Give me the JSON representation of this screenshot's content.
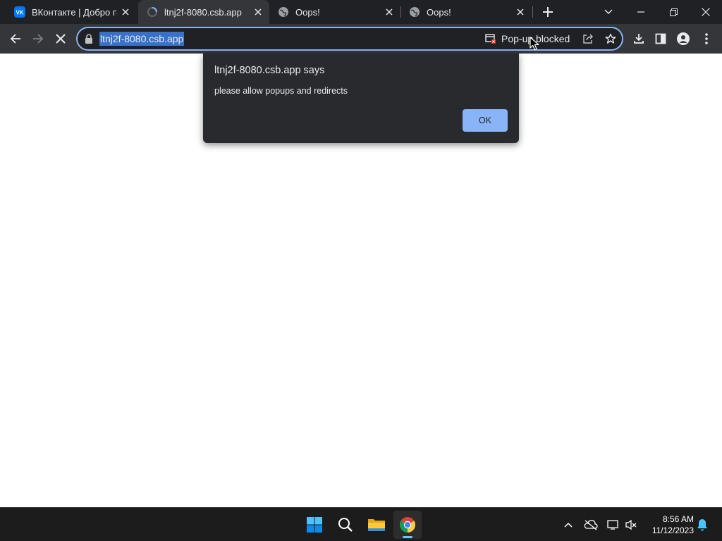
{
  "browser": {
    "tabs": [
      {
        "title": "ВКонтакте | Добро пожаловать",
        "favicon": "vk-icon",
        "active": false
      },
      {
        "title": "ltnj2f-8080.csb.app",
        "favicon": "loading-spinner-icon",
        "active": true
      },
      {
        "title": "Oops!",
        "favicon": "globe-icon",
        "active": false
      },
      {
        "title": "Oops!",
        "favicon": "globe-icon",
        "active": false
      }
    ],
    "address_bar": {
      "url": "ltnj2f-8080.csb.app",
      "popup_blocked_label": "Pop-up blocked"
    }
  },
  "dialog": {
    "title": "ltnj2f-8080.csb.app says",
    "message": "please allow popups and redirects",
    "ok_label": "OK"
  },
  "taskbar": {
    "apps": [
      "start-icon",
      "search-icon",
      "file-explorer-icon",
      "chrome-icon"
    ],
    "clock": {
      "time": "8:56 AM",
      "date": "11/12/2023"
    }
  },
  "colors": {
    "tabstrip_bg": "#202124",
    "toolbar_bg": "#35363a",
    "accent": "#8ab4f8",
    "url_selection": "#3871ca",
    "dialog_bg": "#292a2d",
    "taskbar_bg": "#1c1c1c"
  }
}
